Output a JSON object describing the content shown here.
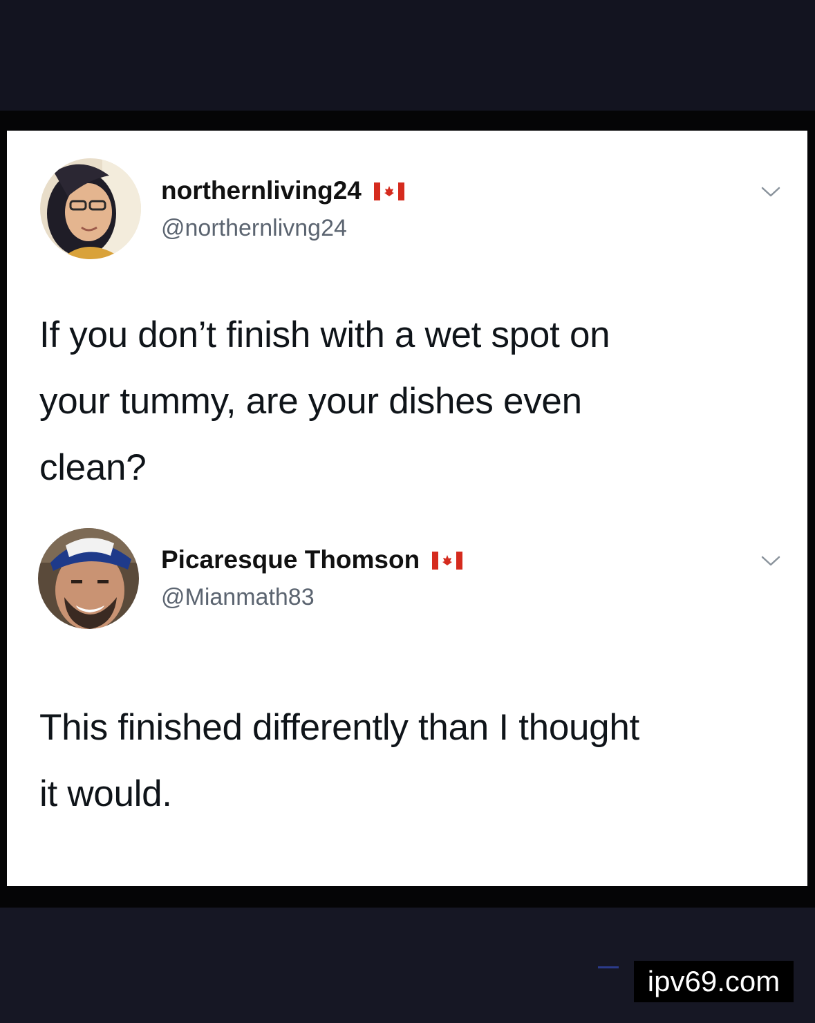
{
  "tweets": [
    {
      "display_name": "northernliving24",
      "handle": "@northernlivng24",
      "text_lines": [
        "If you don’t finish with a wet spot on",
        "your tummy, are your dishes even",
        "clean?"
      ],
      "avatar_icon": "woman-avatar-icon",
      "flag_icon": "canada-flag-icon"
    },
    {
      "display_name": "Picaresque Thomson",
      "handle": "@Mianmath83",
      "text_lines": [
        "This finished differently than I thought",
        "it would."
      ],
      "avatar_icon": "man-with-cap-avatar-icon",
      "flag_icon": "canada-flag-icon"
    }
  ],
  "watermark": "ipv69.com",
  "colors": {
    "background": "#141521",
    "card": "#ffffff",
    "text": "#0f1419",
    "handle": "#5b6470",
    "flag_red": "#d52b1e"
  }
}
